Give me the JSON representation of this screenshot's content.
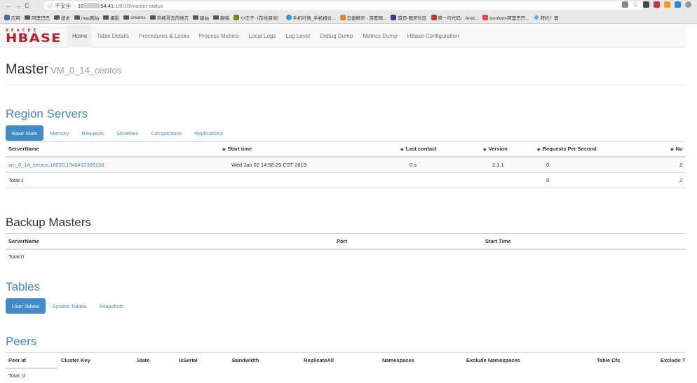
{
  "browser": {
    "nav": {
      "back": "←",
      "forward": "→",
      "reload": "C",
      "info": "ⓘ"
    },
    "security_label": "不安全",
    "url_host_prefix": "10",
    "url_host_suffix": "54.41",
    "url_path": ":16010/master-status",
    "bookmarks": [
      {
        "label": "应用",
        "icon": "apps-icon"
      },
      {
        "label": "阿里巴巴",
        "icon": "folder-icon"
      },
      {
        "label": "技术",
        "icon": "folder-icon"
      },
      {
        "label": "mac网站",
        "icon": "folder-icon"
      },
      {
        "label": "摄影",
        "icon": "folder-icon"
      },
      {
        "label": "creams",
        "icon": "folder-icon"
      },
      {
        "label": "带桂哥去的地方",
        "icon": "folder-icon"
      },
      {
        "label": "建站",
        "icon": "folder-icon"
      },
      {
        "label": "翻墙",
        "icon": "folder-icon"
      },
      {
        "label": "小王子（在线阅读）",
        "icon": "book-icon"
      },
      {
        "label": "手机行情_手机报价...",
        "icon": "phone-icon"
      },
      {
        "label": "云盘精灵 - 百度网...",
        "icon": "cloud-icon"
      },
      {
        "label": "首页-图灵社区",
        "icon": "turing-icon"
      },
      {
        "label": "第一行代码：Andr...",
        "icon": "jd-icon"
      },
      {
        "label": "iconfont-阿里巴巴...",
        "icon": "iconfont-icon"
      },
      {
        "label": "拜托！面",
        "icon": "diamond-icon"
      }
    ],
    "colors": {
      "chrome_bg": "#e8e8e8"
    }
  },
  "logo": {
    "top": "APACHE",
    "main": "HBASE"
  },
  "nav": {
    "items": [
      "Home",
      "Table Details",
      "Procedures & Locks",
      "Process Metrics",
      "Local Logs",
      "Log Level",
      "Debug Dump",
      "Metrics Dump",
      "HBase Configuration"
    ],
    "active": "Home"
  },
  "header": {
    "title": "Master",
    "subtitle": "VM_0_14_centos"
  },
  "region_servers": {
    "title": "Region Servers",
    "tabs": [
      "Base Stats",
      "Memory",
      "Requests",
      "Storefiles",
      "Compactions",
      "Replications"
    ],
    "columns": [
      "ServerName",
      "Start time",
      "Last contact",
      "Version",
      "Requests Per Second",
      "Nu"
    ],
    "rows": [
      {
        "server": "vm_0_14_centos,16020,1546412309158",
        "start": "Wed Jan 02 14:58:29 CST 2019",
        "last_contact": "0 s",
        "version": "2.1.1",
        "rps": "0",
        "num": "2"
      }
    ],
    "total": {
      "label": "Total:1",
      "rps": "0",
      "num": "2"
    }
  },
  "backup_masters": {
    "title": "Backup Masters",
    "columns": [
      "ServerName",
      "Port",
      "Start Time"
    ],
    "total": "Total:0"
  },
  "tables": {
    "title": "Tables",
    "tabs": [
      "User Tables",
      "System Tables",
      "Snapshots"
    ]
  },
  "peers": {
    "title": "Peers",
    "columns": [
      "Peer Id",
      "Cluster Key",
      "State",
      "IsSerial",
      "Bandwidth",
      "ReplicateAll",
      "Namespaces",
      "Exclude Namespaces",
      "Table Cfs",
      "Exclude T"
    ],
    "total": "Total: 0"
  },
  "colors": {
    "accent": "#428bca",
    "logo": "#b2232b"
  }
}
